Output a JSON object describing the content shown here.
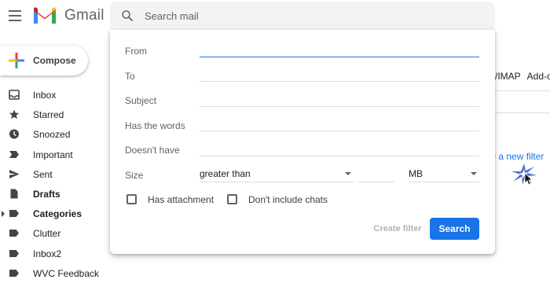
{
  "header": {
    "logo_text": "Gmail",
    "search_placeholder": "Search mail"
  },
  "sidebar": {
    "compose_label": "Compose",
    "items": [
      {
        "label": "Inbox",
        "icon": "inbox-icon"
      },
      {
        "label": "Starred",
        "icon": "star-icon"
      },
      {
        "label": "Snoozed",
        "icon": "clock-icon"
      },
      {
        "label": "Important",
        "icon": "important-icon"
      },
      {
        "label": "Sent",
        "icon": "send-icon"
      },
      {
        "label": "Drafts",
        "icon": "draft-icon"
      },
      {
        "label": "Categories",
        "icon": "label-icon"
      },
      {
        "label": "Clutter",
        "icon": "label-icon"
      },
      {
        "label": "Inbox2",
        "icon": "label-icon"
      },
      {
        "label": "WVC Feedback",
        "icon": "label-icon"
      }
    ]
  },
  "background": {
    "tab_imap": "/IMAP",
    "tab_addons": "Add-o",
    "filter_link": "te a new filter"
  },
  "search_panel": {
    "from_label": "From",
    "to_label": "To",
    "subject_label": "Subject",
    "has_words_label": "Has the words",
    "doesnt_have_label": "Doesn't have",
    "size_label": "Size",
    "size_comparator": "greater than",
    "size_unit": "MB",
    "has_attachment_label": "Has attachment",
    "dont_include_chats_label": "Don't include chats",
    "create_filter_label": "Create filter",
    "search_button_label": "Search"
  },
  "colors": {
    "accent": "#1a73e8",
    "text": "#202124",
    "muted": "#5f6368"
  }
}
